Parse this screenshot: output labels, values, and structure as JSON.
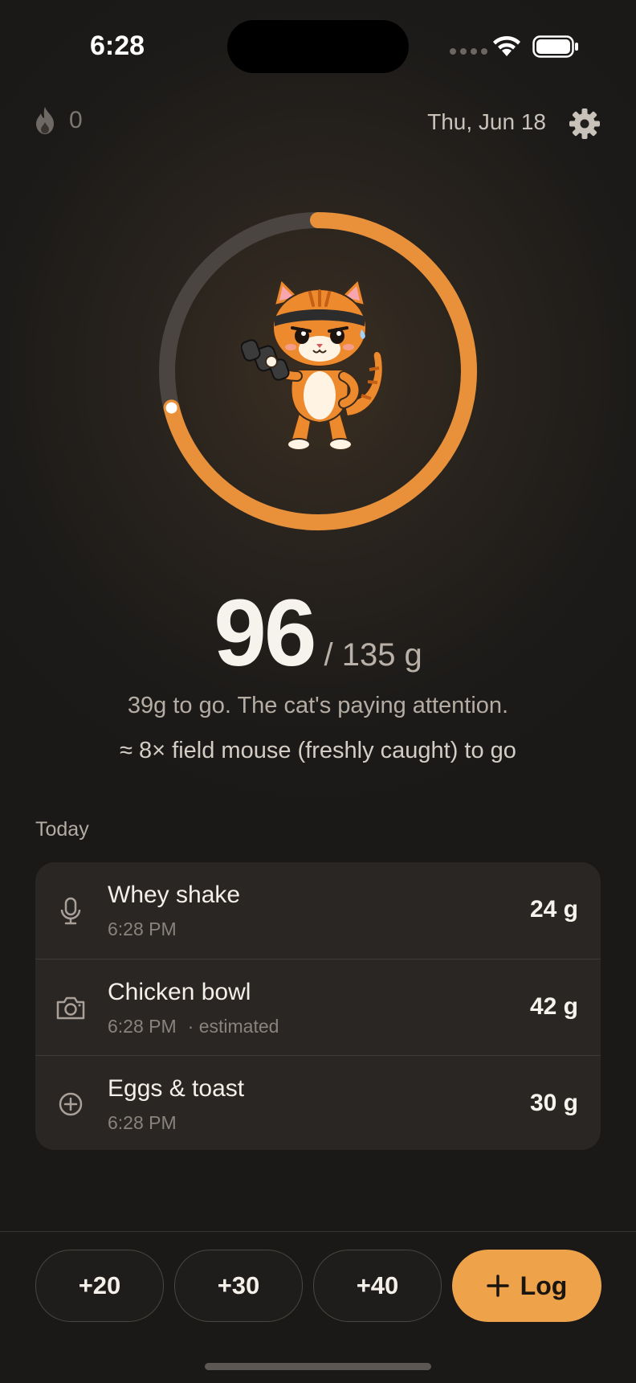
{
  "status_bar": {
    "time": "6:28"
  },
  "header": {
    "streak_icon": "flame-icon",
    "streak_count": "0",
    "date": "Thu, Jun 18",
    "settings_icon": "gear-icon"
  },
  "ring": {
    "progress_fraction": 0.711,
    "accent_color": "#e8913a",
    "track_color": "#4a4540",
    "mascot": "cat-with-dumbbell-mascot"
  },
  "progress": {
    "current": "96",
    "goal_text": "/ 135 g",
    "message": "39g to go. The cat's paying attention.",
    "equivalence": "≈ 8× field mouse (freshly caught) to go"
  },
  "today": {
    "title": "Today",
    "entries": [
      {
        "icon": "microphone-icon",
        "name": "Whey shake",
        "time": "6:28 PM",
        "note": "",
        "amount": "24 g"
      },
      {
        "icon": "camera-icon",
        "name": "Chicken bowl",
        "time": "6:28 PM",
        "note": "· estimated",
        "amount": "42 g"
      },
      {
        "icon": "plus-circle-icon",
        "name": "Eggs & toast",
        "time": "6:28 PM",
        "note": "",
        "amount": "30 g"
      }
    ]
  },
  "actions": {
    "quick_add": [
      "+20",
      "+30",
      "+40"
    ],
    "log_label": "Log",
    "log_icon": "plus-icon",
    "log_color": "#eea24a"
  }
}
